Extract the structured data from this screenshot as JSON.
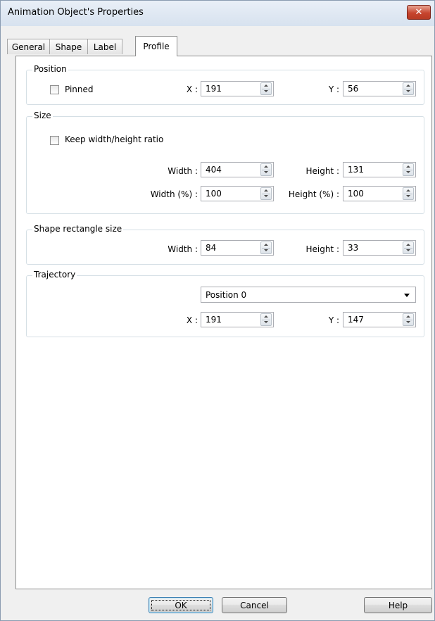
{
  "window": {
    "title": "Animation Object's Properties",
    "close_glyph": "✕"
  },
  "tabs": [
    "General",
    "Shape",
    "Label",
    "Profile"
  ],
  "active_tab": "Profile",
  "position": {
    "legend": "Position",
    "pinned_label": "Pinned",
    "x_label": "X :",
    "x_value": "191",
    "y_label": "Y :",
    "y_value": "56"
  },
  "size": {
    "legend": "Size",
    "keep_ratio_label": "Keep width/height ratio",
    "width_label": "Width :",
    "width_value": "404",
    "height_label": "Height :",
    "height_value": "131",
    "width_pct_label": "Width (%) :",
    "width_pct_value": "100",
    "height_pct_label": "Height (%) :",
    "height_pct_value": "100"
  },
  "shape_rect": {
    "legend": "Shape rectangle size",
    "width_label": "Width :",
    "width_value": "84",
    "height_label": "Height :",
    "height_value": "33"
  },
  "trajectory": {
    "legend": "Trajectory",
    "selected": "Position 0",
    "x_label": "X :",
    "x_value": "191",
    "y_label": "Y :",
    "y_value": "147"
  },
  "buttons": {
    "ok": "OK",
    "cancel": "Cancel",
    "help": "Help"
  }
}
